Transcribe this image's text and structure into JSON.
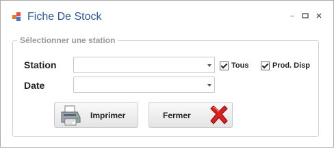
{
  "window": {
    "title": "Fiche De Stock",
    "controls": {
      "minimize": "–",
      "maximize": "□",
      "close": "×"
    },
    "icon_colors": [
      "#e67e22",
      "#3a7bd5",
      "#e74c3c"
    ]
  },
  "group": {
    "legend": "Sélectionner une station",
    "station_label": "Station",
    "station_value": "",
    "date_label": "Date",
    "date_value": "",
    "check_tous": {
      "label": "Tous",
      "checked": true
    },
    "check_prod_disp": {
      "label": "Prod. Disp",
      "checked": true
    }
  },
  "buttons": {
    "print_label": "Imprimer",
    "close_label": "Fermer"
  },
  "colors": {
    "title_text": "#2b5797",
    "close_x": "#e02020"
  }
}
